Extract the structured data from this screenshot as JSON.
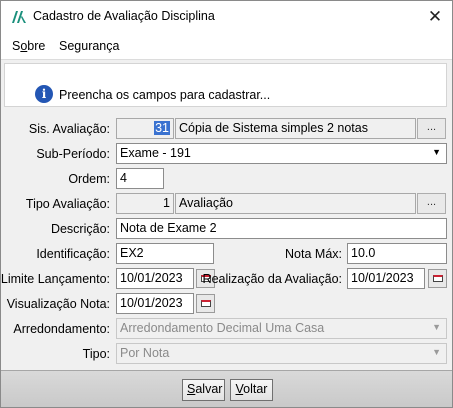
{
  "window": {
    "title": "Cadastro de Avaliação Disciplina",
    "close_label": "✕"
  },
  "menu": {
    "items": [
      {
        "label_pre": "S",
        "label_u": "o",
        "label_post": "bre"
      },
      {
        "label_pre": "Segurança",
        "label_u": "",
        "label_post": ""
      }
    ]
  },
  "info": {
    "message": "Preencha os campos para cadastrar..."
  },
  "form": {
    "sis_avaliacao": {
      "label": "Sis. Avaliação:",
      "code": "31",
      "description": "Cópia de Sistema simples 2 notas",
      "lookup": "..."
    },
    "sub_periodo": {
      "label": "Sub-Período:",
      "value": "Exame  - 191"
    },
    "ordem": {
      "label": "Ordem:",
      "value": "4"
    },
    "tipo_avaliacao": {
      "label": "Tipo Avaliação:",
      "code": "1",
      "description": "Avaliação",
      "lookup": "..."
    },
    "descricao": {
      "label": "Descrição:",
      "value": "Nota de Exame 2"
    },
    "identificacao": {
      "label": "Identificação:",
      "value": "EX2"
    },
    "nota_max": {
      "label": "Nota Máx:",
      "value": "10.0"
    },
    "limite_lancamento": {
      "label": "Limite Lançamento:",
      "value": "10/01/2023"
    },
    "realizacao_avaliacao": {
      "label": "Realização da Avaliação:",
      "value": "10/01/2023"
    },
    "visualizacao_nota": {
      "label": "Visualização Nota:",
      "value": "10/01/2023"
    },
    "arredondamento": {
      "label": "Arredondamento:",
      "value": "Arredondamento Decimal Uma Casa"
    },
    "tipo": {
      "label": "Tipo:",
      "value": "Por Nota"
    }
  },
  "buttons": {
    "salvar": {
      "u": "S",
      "rest": "alvar"
    },
    "voltar": {
      "u": "V",
      "rest": "oltar"
    }
  }
}
